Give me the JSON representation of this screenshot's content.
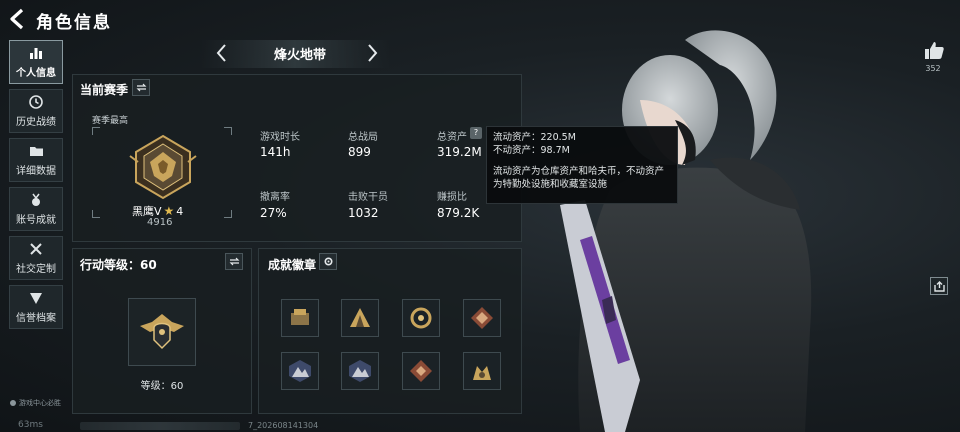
{
  "header": {
    "title": "角色信息"
  },
  "nav": {
    "items": [
      {
        "label": "个人信息",
        "icon": "bar-chart-icon",
        "active": true
      },
      {
        "label": "历史战绩",
        "icon": "clock-icon",
        "active": false
      },
      {
        "label": "详细数据",
        "icon": "folder-icon",
        "active": false
      },
      {
        "label": "账号成就",
        "icon": "medal-icon",
        "active": false
      },
      {
        "label": "社交定制",
        "icon": "tools-icon",
        "active": false
      },
      {
        "label": "信誉档案",
        "icon": "shield-icon",
        "active": false
      }
    ],
    "footer_label": "游戏中心必胜"
  },
  "mode": {
    "label": "烽火地带"
  },
  "season": {
    "title": "当前赛季",
    "subtitle": "赛季最高",
    "rank_name": "黑鹰V",
    "rank_stars": "4",
    "rank_score": "4916",
    "stats": [
      {
        "label": "游戏时长",
        "value": "141h"
      },
      {
        "label": "总战局",
        "value": "899"
      },
      {
        "label": "总资产",
        "value": "319.2M"
      },
      {
        "label": "撤离率",
        "value": "27%"
      },
      {
        "label": "击败干员",
        "value": "1032"
      },
      {
        "label": "赚损比",
        "value": "879.2K"
      }
    ]
  },
  "tooltip": {
    "liquid": "流动资产：220.5M",
    "fixed": "不动资产：98.7M",
    "desc_line1": "流动资产为仓库资产和哈夫币，不动资产",
    "desc_line2": "为特勤处设施和收藏室设施"
  },
  "level": {
    "title": "行动等级：60",
    "text": "等级：60"
  },
  "achievements": {
    "title": "成就徽章",
    "badges": [
      "cargo-badge-icon",
      "tent-badge-icon",
      "ring-badge-icon",
      "crest-badge-icon",
      "mountain-badge-icon",
      "mountain-badge-icon",
      "crest-badge-icon",
      "bull-badge-icon"
    ]
  },
  "social": {
    "like_count": "352"
  },
  "footer": {
    "ping": "63ms",
    "uid_suffix": "7_202608141304"
  },
  "colors": {
    "accent_gold": "#c9a55c",
    "tooltip_bg": "#0a0c0e",
    "panel_bg": "#181e21"
  }
}
